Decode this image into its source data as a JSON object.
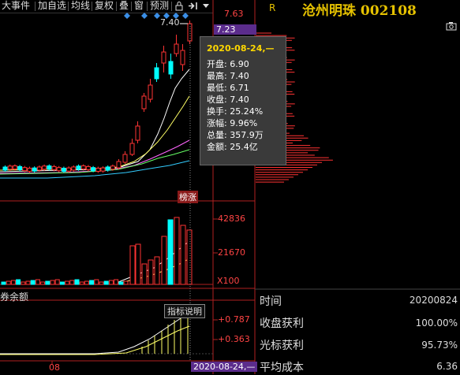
{
  "toolbar": {
    "items": [
      "大事件",
      "加自选",
      "均线",
      "复权",
      "叠",
      "窗",
      "预测"
    ],
    "lock_icon": "lock-icon",
    "next_icon": "next-page-icon",
    "menu_icon": "dropdown-menu-icon"
  },
  "header": {
    "r_tag": "R",
    "stock_title": "沧州明珠 002108",
    "camera_icon": "camera-icon"
  },
  "price_scale": {
    "top_price": "7.63",
    "current_price": "7.23",
    "peak_label": "7.40"
  },
  "tooltip": {
    "date": "2020-08-24,—",
    "rows": [
      "开盘: 6.90",
      "最高: 7.40",
      "最低: 6.71",
      "收盘: 7.40",
      "换手: 25.24%",
      "涨幅: 9.96%",
      "总量: 357.9万",
      "金额: 25.4亿"
    ]
  },
  "badge": "榜涨",
  "volume_scale": {
    "top": "42836",
    "mid": "21670",
    "unit": "X100"
  },
  "margin_label": "券余额",
  "indicator": {
    "help_button": "指标说明",
    "top": "+0.787",
    "mid": "+0.363"
  },
  "x_axis": {
    "month_label": "08",
    "current_date": "2020-08-24,—"
  },
  "info": {
    "time_label": "时间",
    "time_value": "20200824",
    "close_profit_label": "收盘获利",
    "close_profit_value": "100.00%",
    "cursor_profit_label": "光标获利",
    "cursor_profit_value": "95.73%",
    "avg_cost_label": "平均成本",
    "avg_cost_value": "6.36"
  },
  "colors": {
    "up": "#ff3333",
    "down": "#00ffff",
    "ma5": "#ffffff",
    "ma10": "#ffff66",
    "ma20": "#ff66ff",
    "ma30": "#66ff66",
    "ma60": "#33ccff",
    "chip": "#ff3333",
    "accent": "#e6c200"
  }
}
